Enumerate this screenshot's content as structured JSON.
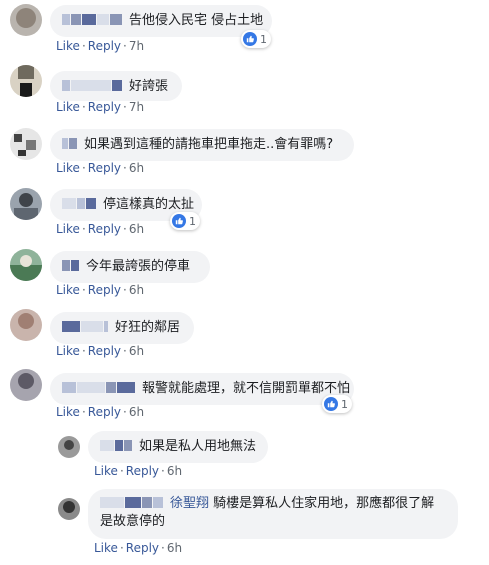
{
  "action_labels": {
    "like": "Like",
    "reply": "Reply",
    "separator": "·"
  },
  "colors": {
    "link": "#385898",
    "bubble": "#f2f3f5",
    "meta": "#606770",
    "like_badge": "#3578e5"
  },
  "comments": [
    {
      "text": "告他侵入民宅 侵占土地",
      "time": "7h",
      "reactions": "1"
    },
    {
      "text": "好誇張",
      "time": "7h",
      "reactions": ""
    },
    {
      "text": "如果遇到這種的請拖車把車拖走..會有罪嗎?",
      "time": "6h",
      "reactions": ""
    },
    {
      "text": "停這樣真的太扯",
      "time": "6h",
      "reactions": "1"
    },
    {
      "text": "今年最誇張的停車",
      "time": "6h",
      "reactions": ""
    },
    {
      "text": "好狂的鄰居",
      "time": "6h",
      "reactions": ""
    },
    {
      "text": "報警就能處理，就不信開罰單都不怕",
      "time": "6h",
      "reactions": "1"
    }
  ],
  "replies": [
    {
      "text": "如果是私人用地無法",
      "time": "6h"
    },
    {
      "mention": "徐聖翔",
      "text_line1": "騎樓是算私人住家用地，那應都很了解",
      "text_line2": "是故意停的",
      "time": "6h"
    }
  ]
}
